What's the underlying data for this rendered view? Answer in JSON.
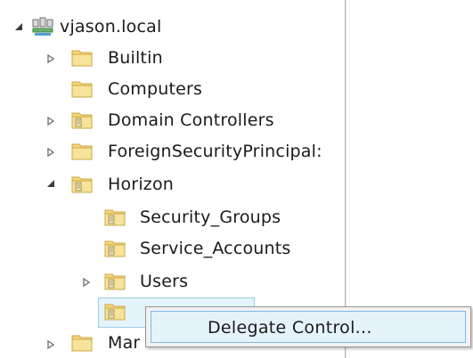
{
  "tree": {
    "root": {
      "label": "vjason.local",
      "icon": "domain-icon",
      "state": "expanded"
    },
    "nodes": [
      {
        "label": "Builtin",
        "icon": "folder-icon",
        "state": "collapsed"
      },
      {
        "label": "Computers",
        "icon": "folder-icon",
        "state": "leaf"
      },
      {
        "label": "Domain Controllers",
        "icon": "ou-icon",
        "state": "collapsed"
      },
      {
        "label": "ForeignSecurityPrincipal:",
        "icon": "folder-icon",
        "state": "collapsed"
      },
      {
        "label": "Horizon",
        "icon": "ou-icon",
        "state": "expanded"
      },
      {
        "label": "Security_Groups",
        "icon": "ou-icon",
        "state": "leaf"
      },
      {
        "label": "Service_Accounts",
        "icon": "ou-icon",
        "state": "leaf"
      },
      {
        "label": "Users",
        "icon": "ou-icon",
        "state": "collapsed"
      },
      {
        "label": "",
        "icon": "ou-icon",
        "state": "leaf",
        "selected": true
      },
      {
        "label": "Mar",
        "icon": "folder-icon",
        "state": "collapsed"
      }
    ]
  },
  "context_menu": {
    "items": [
      {
        "label": "Delegate Control..."
      }
    ]
  },
  "colors": {
    "selection_fill": "#e5f3fb",
    "selection_border": "#9ccde9",
    "menu_background": "#f2f2f2",
    "folder_yellow": "#f5d77a"
  }
}
